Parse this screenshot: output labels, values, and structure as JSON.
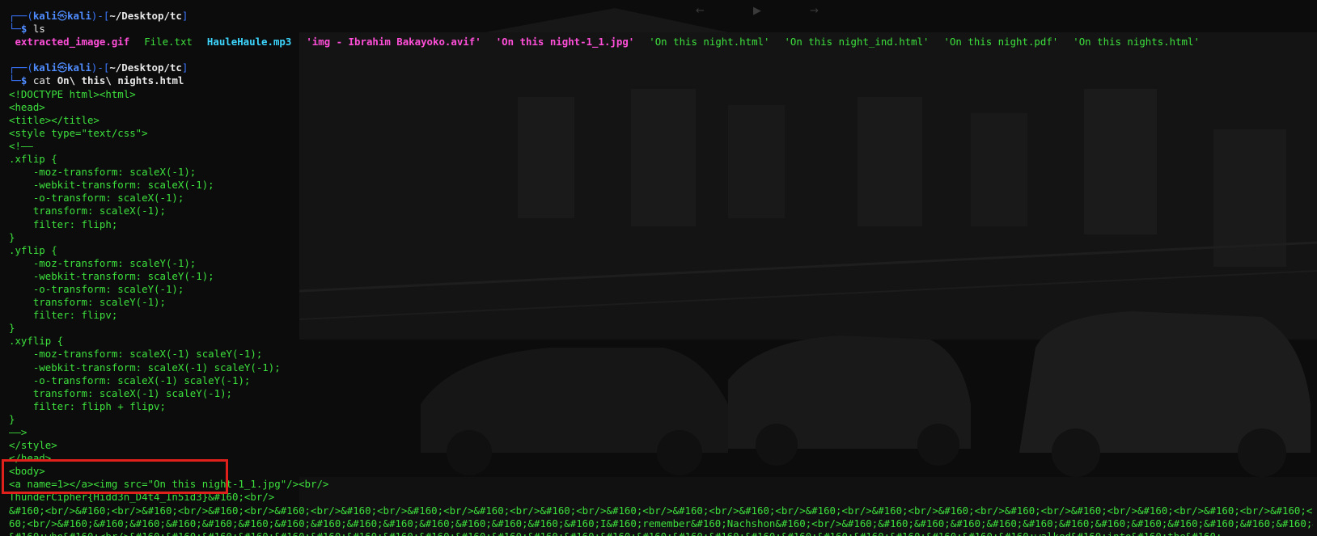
{
  "prompt": {
    "user": "kali",
    "at_symbol": "㉿",
    "host": "kali",
    "path": "~/Desktop/tc",
    "dollar": "$"
  },
  "commands": {
    "ls": "ls",
    "cat": "cat",
    "cat_arg": "On\\ this\\ nights.html"
  },
  "ls_output": [
    {
      "name": "extracted_image.gif",
      "kind": "gif"
    },
    {
      "name": "File.txt",
      "kind": "txt"
    },
    {
      "name": "HauleHaule.mp3",
      "kind": "mp3"
    },
    {
      "name": "'img - Ibrahim Bakayoko.avif'",
      "kind": "avif"
    },
    {
      "name": "'On this night-1_1.jpg'",
      "kind": "jpg"
    },
    {
      "name": "'On this night.html'",
      "kind": "html"
    },
    {
      "name": "'On this night_ind.html'",
      "kind": "html"
    },
    {
      "name": "'On this night.pdf'",
      "kind": "pdf"
    },
    {
      "name": "'On this nights.html'",
      "kind": "html"
    }
  ],
  "html_output": [
    "<!DOCTYPE html><html>",
    "<head>",
    "<title></title>",
    "<style type=\"text/css\">",
    "<!——",
    ".xflip {",
    "    -moz-transform: scaleX(-1);",
    "    -webkit-transform: scaleX(-1);",
    "    -o-transform: scaleX(-1);",
    "    transform: scaleX(-1);",
    "    filter: fliph;",
    "}",
    ".yflip {",
    "    -moz-transform: scaleY(-1);",
    "    -webkit-transform: scaleY(-1);",
    "    -o-transform: scaleY(-1);",
    "    transform: scaleY(-1);",
    "    filter: flipv;",
    "}",
    ".xyflip {",
    "    -moz-transform: scaleX(-1) scaleY(-1);",
    "    -webkit-transform: scaleX(-1) scaleY(-1);",
    "    -o-transform: scaleX(-1) scaleY(-1);",
    "    transform: scaleX(-1) scaleY(-1);",
    "    filter: fliph + flipv;",
    "}",
    "——>",
    "</style>",
    "</head>",
    "<body>",
    "<a name=1></a><img src=\"On this night-1_1.jpg\"/><br/>",
    "ThunderCipher{Hidd3n_D4t4_In5id3}&#160;<br/>",
    "&#160;<br/>&#160;<br/>&#160;<br/>&#160;<br/>&#160;<br/>&#160;<br/>&#160;<br/>&#160;<br/>&#160;<br/>&#160;<br/>&#160;<br/>&#160;<br/>&#160;<br/>&#160;<br/>&#160;<br/>&#160;<br/>&#160;<br/>&#160;<br/>&#160;<br/>&#160;<br/>&#1",
    "60;<br/>&#160;&#160;&#160;&#160;&#160;&#160;&#160;&#160;&#160;&#160;&#160;&#160;&#160;&#160;&#160;I&#160;remember&#160;Nachshon&#160;<br/>&#160;&#160;&#160;&#160;&#160;&#160;&#160;&#160;&#160;&#160;&#160;&#160;&#160;&#160;&#16",
    "&#160;who&#160;<br/>&#160;&#160;&#160;&#160;&#160;&#160;&#160;&#160;&#160;&#160;&#160;&#160;&#160;&#160;&#160;&#160;&#160;&#160;&#160;&#160;&#160;&#160;&#160;&#160;&#160;walked&#160;into&#160;the&#160;"
  ],
  "colors": {
    "highlight_border": "#e0201b",
    "terminal_green": "#3de13d",
    "prompt_blue": "#4f8cff"
  }
}
